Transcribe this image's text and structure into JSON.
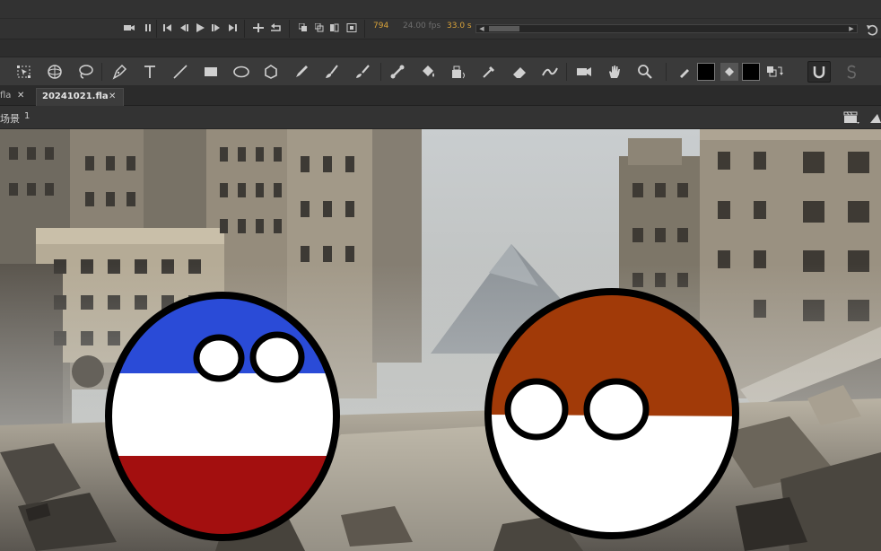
{
  "timeline": {
    "current_frame": "794",
    "frame_rate": "24.00 fps",
    "elapsed_time": "33.0 s",
    "controls": [
      "go-to-first-frame",
      "step-back",
      "play",
      "step-forward",
      "go-to-last-frame"
    ]
  },
  "tools": [
    "free-transform",
    "3d-rotation",
    "lasso",
    "pen",
    "text",
    "line",
    "rectangle",
    "oval",
    "polystar",
    "pencil",
    "paint-brush",
    "brush",
    "bone",
    "paint-bucket",
    "ink-bottle",
    "eyedropper",
    "eraser",
    "width",
    "camera",
    "hand",
    "zoom"
  ],
  "colors": {
    "stroke": "#000000",
    "fill": "#000000",
    "accent_orange": "#d9a33a"
  },
  "tabs": [
    {
      "label": "fla",
      "active": false
    },
    {
      "label": "20241021.fla",
      "active": true
    }
  ],
  "edit_bar": {
    "scene_label": "场景",
    "scene_number": "1"
  },
  "stage": {
    "scene": "ruined city street with two countryballs",
    "left_ball_flag": [
      "#2a4bd7",
      "#ffffff",
      "#a30f0f"
    ],
    "right_ball_flag": [
      "#a13a08",
      "#ffffff"
    ]
  }
}
